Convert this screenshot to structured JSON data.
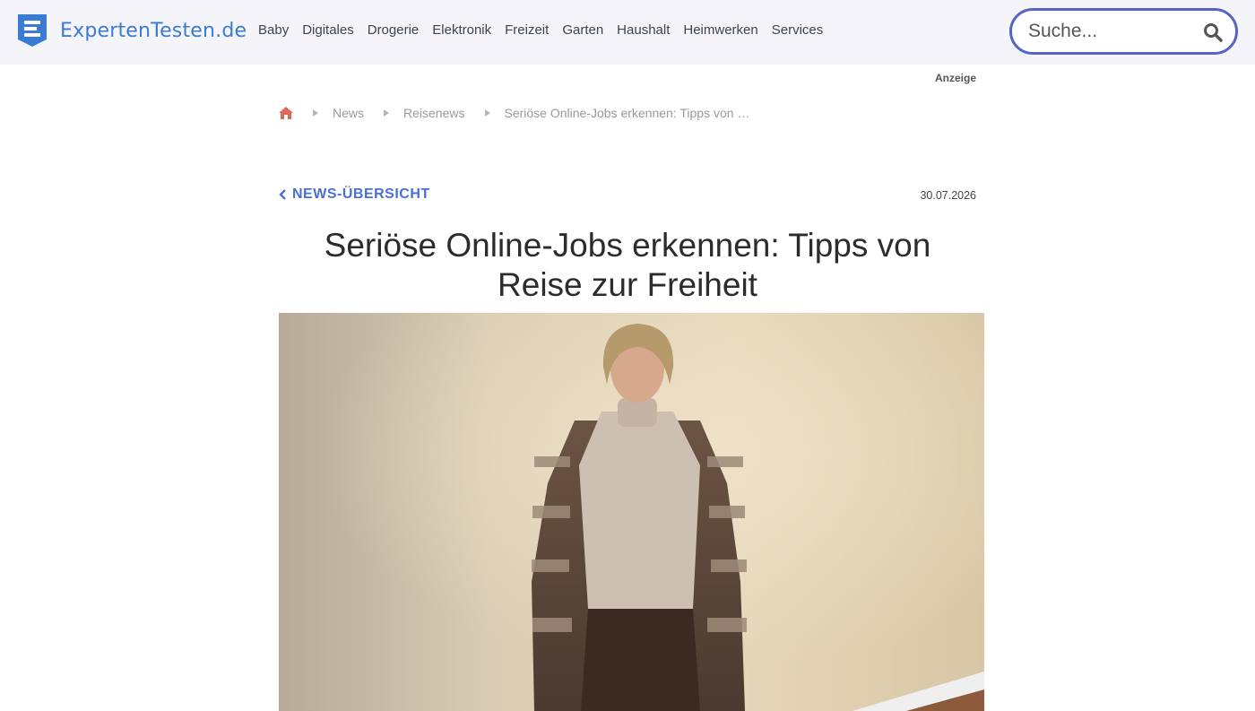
{
  "header": {
    "logo_text": "ExpertenTesten.de",
    "nav": [
      "Baby",
      "Digitales",
      "Drogerie",
      "Elektronik",
      "Freizeit",
      "Garten",
      "Haushalt",
      "Heimwerken",
      "Services"
    ],
    "search": {
      "placeholder": "Suche...",
      "icon": "search-icon"
    }
  },
  "ad_label": "Anzeige",
  "breadcrumb": {
    "home_icon": "home-icon",
    "items": [
      "News",
      "Reisenews",
      "Seriöse Online-Jobs erkennen: Tipps von …"
    ]
  },
  "article": {
    "back_label": "NEWS-ÜBERSICHT",
    "date": "30.07.2026",
    "title": "Seriöse Online-Jobs erkennen: Tipps von Reise zur Freiheit"
  },
  "colors": {
    "brand": "#3a7bd5",
    "accent": "#4a6fd6",
    "search_border": "#5565c5",
    "home_icon": "#e0685a",
    "header_bg": "#f4f4f9"
  }
}
